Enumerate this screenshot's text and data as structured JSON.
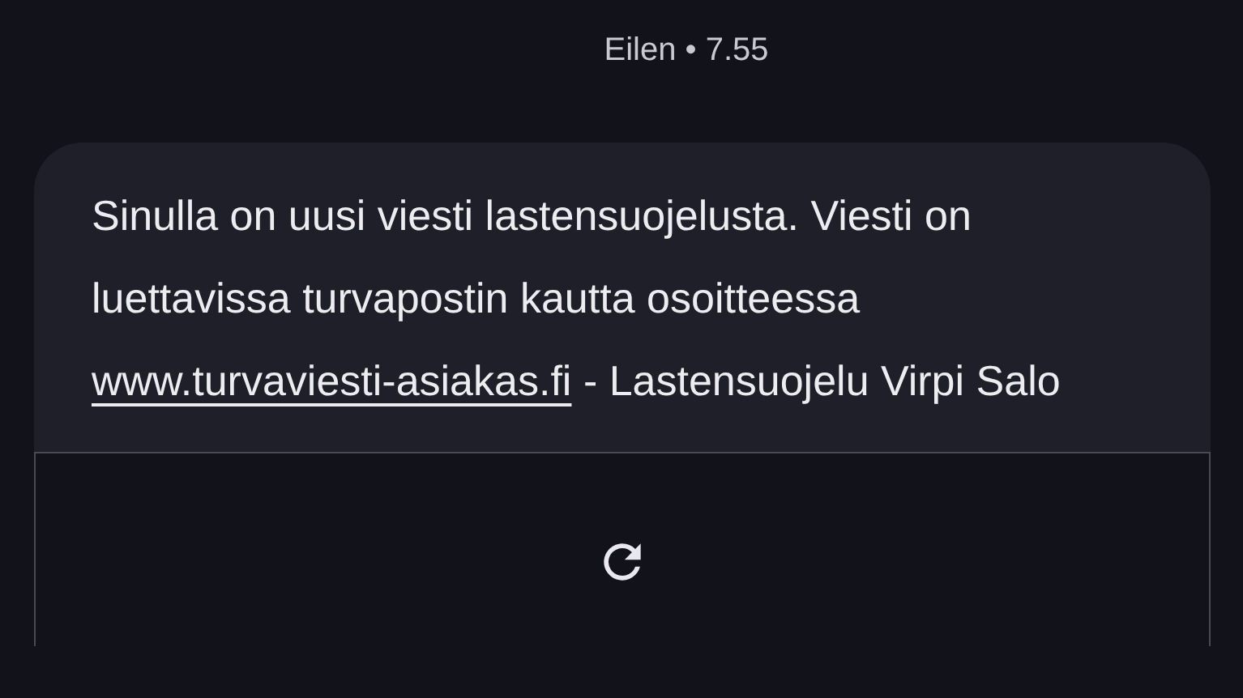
{
  "timestamp": "Eilen • 7.55",
  "message": {
    "text_before": "Sinulla on uusi viesti lastensuojelusta. Viesti on luettavissa turvapostin kautta osoitteessa",
    "link": "www.turvaviesti-asiakas.fi",
    "text_after": "- Lastensuojelu Virpi Salo"
  },
  "preview": {
    "kind": "loading"
  }
}
